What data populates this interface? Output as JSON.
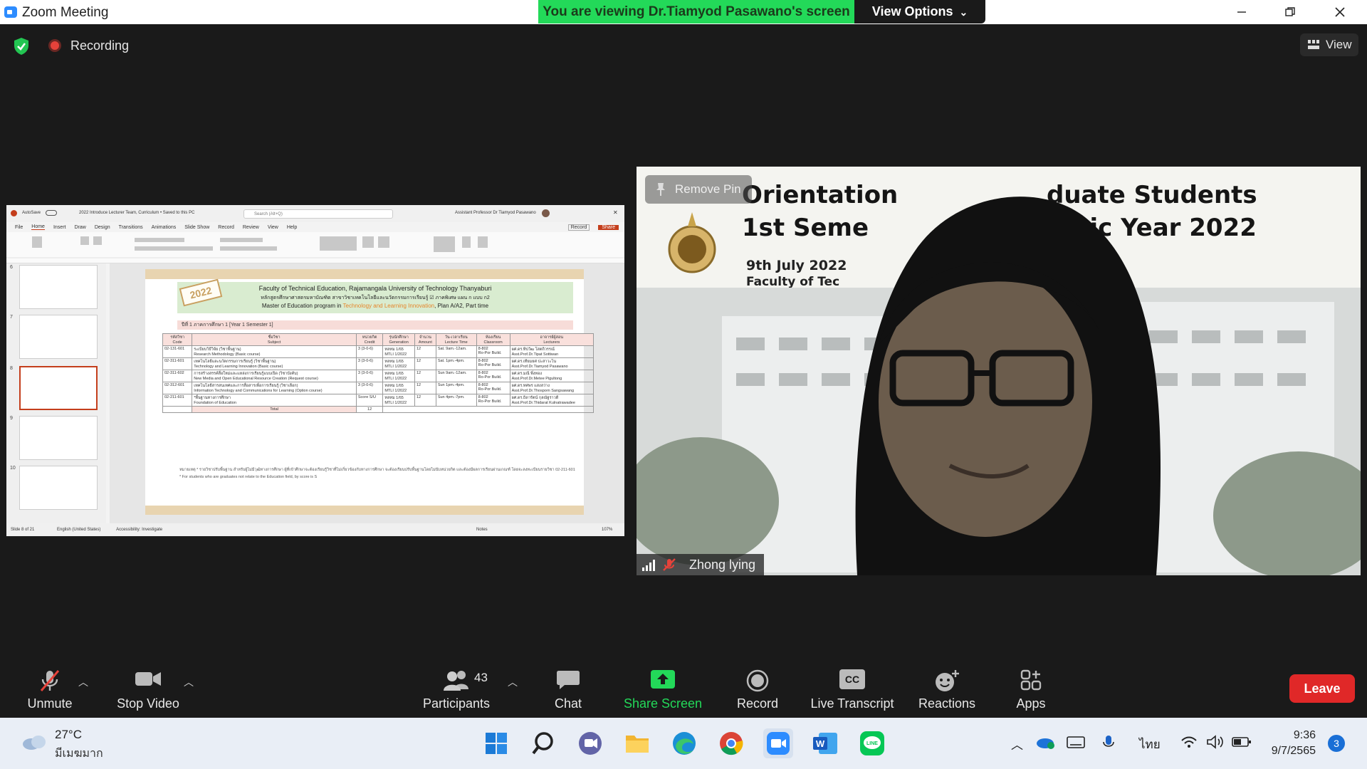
{
  "window": {
    "title": "Zoom Meeting",
    "viewing_banner": "You are viewing Dr.Tiamyod Pasawano's screen",
    "view_options": "View Options",
    "view_options_caret": "⌄"
  },
  "top_overlay": {
    "recording_label": "Recording",
    "view_label": "View"
  },
  "shared_screen": {
    "ppt_title": "2022 Introduce Lecturer Team, Curriculum • Saved to this PC",
    "autosave": "AutoSave",
    "search_placeholder": "Search (Alt+Q)",
    "user": "Assistant Professor Dr Tiamyod Pasawano",
    "menu": [
      "File",
      "Home",
      "Insert",
      "Draw",
      "Design",
      "Transitions",
      "Animations",
      "Slide Show",
      "Record",
      "Review",
      "View",
      "Help"
    ],
    "record_btn": "Record",
    "share_btn": "Share",
    "thumb_numbers": [
      "6",
      "7",
      "8",
      "9",
      "10"
    ],
    "status_left": "Slide 8 of 21",
    "status_lang": "English (United States)",
    "status_access": "Accessibility: Investigate",
    "status_notes": "Notes",
    "status_zoom": "107%",
    "slide": {
      "badge": "2022",
      "line1": "Faculty of Technical Education, Rajamangala University of Technology Thanyaburi",
      "line2": "หลักสูตรศึกษาศาสตรมหาบัณฑิต สาขาวิชาเทคโนโลยีและนวัตกรรมการเรียนรู้ ☑ ภาคพิเศษ แผน ก แบบ ก2",
      "line3a": "Master of Education program in ",
      "line3b": "Technology and Learning Innovation",
      "line3c": ", Plan A/A2, Part time",
      "year_bar": "ปีที่ 1 ภาคการศึกษา 1 [Year 1 Semester 1]",
      "headers": [
        [
          "รหัสวิชา",
          "Code"
        ],
        [
          "ชื่อวิชา",
          "Subject"
        ],
        [
          "หน่วยกิต",
          "Credit"
        ],
        [
          "รุ่นนักศึกษา",
          "Generation"
        ],
        [
          "จำนวน",
          "Amount"
        ],
        [
          "วัน-เวลาเรียน",
          "Lecture Time"
        ],
        [
          "ห้องเรียน",
          "Classroom"
        ],
        [
          "อาจารย์ผู้สอน",
          "Lecturers"
        ]
      ],
      "rows": [
        {
          "code": "02-131-601",
          "subject_th": "ระเบียบวิธีวิจัย (วิชาพื้นฐาน)",
          "subject_en": "Research Methodology (Basic course)",
          "credit": "3 (3-0-6)",
          "gen1": "ทลทม 1/65",
          "gen2": "MTLI 1/2022",
          "amount": "12",
          "time": "Sat. 9am.-12am.",
          "room1": "8-802",
          "room2": "Ro-Por Build.",
          "lect_th": "ผศ.ดร.ทิปวัฒ โสตถิวรรณ์",
          "lect_en": "Asst.Prof.Dr.Tipat Sottiwan"
        },
        {
          "code": "02-311-601",
          "subject_th": "เทคโนโลยีและนวัตกรรมการเรียนรู้ (วิชาพื้นฐาน)",
          "subject_en": "Technology and Learning Innovation (Basic course)",
          "credit": "3 (3-0-6)",
          "gen1": "ทลทม 1/65",
          "gen2": "MTLI 1/2022",
          "amount": "12",
          "time": "Sat. 1pm.-4pm.",
          "room1": "8-802",
          "room2": "Ro-Por Build.",
          "lect_th": "ผศ.ดร.เทียมยศ ปะสาวะโน",
          "lect_en": "Asst.Prof.Dr.Tiamyod Pasawano"
        },
        {
          "code": "02-311-602",
          "subject_th": "การสร้างสรรค์สื่อใหม่และแหล่งการเรียนรู้แบบเปิด (วิชาบังคับ)",
          "subject_en": "New Media and Open Educational Resource Creation (Request course)",
          "credit": "3 (3-0-6)",
          "gen1": "ทลทม 1/65",
          "gen2": "MTLI 1/2022",
          "amount": "12",
          "time": "Sun 9am.-12am.",
          "room1": "8-802",
          "room2": "Ro-Por Build.",
          "lect_th": "ผศ.ดร.มณี พึ่งทอง",
          "lect_en": "Asst.Prof.Dr.Metee Pigultong"
        },
        {
          "code": "02-312-601",
          "subject_th": "เทคโนโลยีสารสนเทศและการสื่อสารเพื่อการเรียนรู้ (วิชาเลือก)",
          "subject_en": "Information Technology and Communications for Learning (Option course)",
          "credit": "3 (3-0-6)",
          "gen1": "ทลทม 1/65",
          "gen2": "MTLI 1/2022",
          "amount": "12",
          "time": "Sun 1pm.-4pm.",
          "room1": "8-802",
          "room2": "Ro-Por Build.",
          "lect_th": "ผศ.ดร.ทศพร แสงสว่าง",
          "lect_en": "Asst.Prof.Dr.Thosporn Sangsawang"
        },
        {
          "code": "02-211-601",
          "subject_th": "*พื้นฐานทางการศึกษา",
          "subject_en": "Foundation of Education",
          "credit": "Score S/U",
          "gen1": "ทลทม 1/65",
          "gen2": "MTLI 1/2022",
          "amount": "12",
          "time": "Sun 4pm.-7pm.",
          "room1": "8-802",
          "room2": "Ro-Por Build.",
          "lect_th": "ผศ.ดร.ธิดารัตน์ กุลณัฐราวดี",
          "lect_en": "Asst.Prof.Dr.Thidarat Kulnatrawadee"
        }
      ],
      "total_label": "Total",
      "total_value": "12",
      "note1": "หมายเหตุ * รายวิชาปรับพื้นฐาน สำหรับผู้ไม่มีวุฒิทางการศึกษา ผู้ที่เข้าศึกษาจะต้องเรียนรู้วิชาที่ไม่เกี่ยวข้องกับทางการศึกษา จะต้องเรียนปรับพื้นฐานโดยไม่นับหน่วยกิต และต้องมีผลการเรียนผ่านเกณฑ์ โดยจะลงทะเบียนรายวิชา 02-211-601",
      "note2": "* For students who are graduates not relate to the Education field, by score is S"
    }
  },
  "video": {
    "remove_pin": "Remove Pin",
    "participant_name": "Zhong lying",
    "banner_line1_left": "Orientation",
    "banner_line1_right": "duate Students",
    "banner_line2_left": "1st Seme",
    "banner_line2_right": "emic Year 2022",
    "banner_date": "9th July 2022",
    "banner_faculty": "Faculty of Tec"
  },
  "toolbar": {
    "unmute": "Unmute",
    "stop_video": "Stop Video",
    "participants": "Participants",
    "participant_count": "43",
    "chat": "Chat",
    "share_screen": "Share Screen",
    "record": "Record",
    "live_transcript": "Live Transcript",
    "cc": "CC",
    "reactions": "Reactions",
    "apps": "Apps",
    "leave": "Leave"
  },
  "taskbar": {
    "temperature": "27°C",
    "condition": "มีเมฆมาก",
    "language": "ไทย",
    "time": "9:36",
    "date": "9/7/2565",
    "notifications": "3"
  },
  "colors": {
    "zoom_blue": "#2d8cff",
    "banner_green": "#23d959",
    "share_green": "#23d959",
    "leave_red": "#e02828",
    "record_red": "#e6423a"
  }
}
